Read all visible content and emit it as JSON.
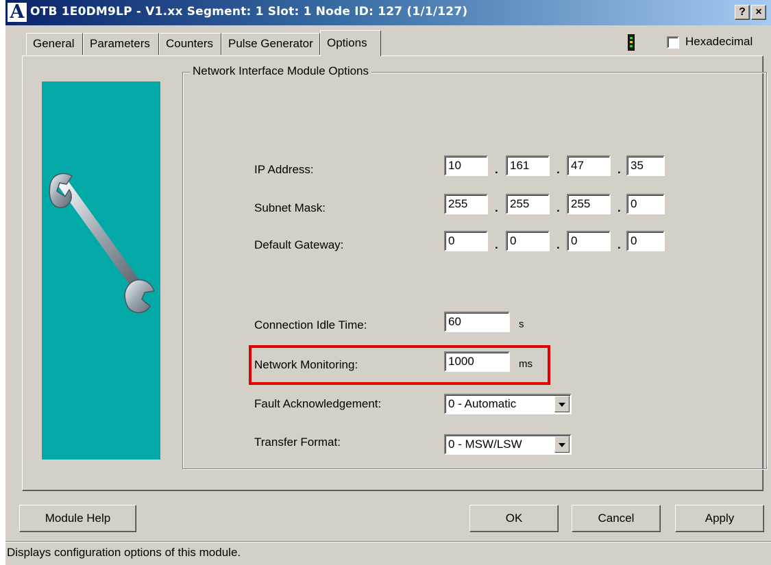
{
  "window": {
    "logo": "A",
    "title": "OTB 1E0DM9LP - V1.xx Segment: 1 Slot: 1 Node ID: 127 (1/1/127)",
    "help_button": "?",
    "close_button": "×"
  },
  "tabs": [
    {
      "label": "General"
    },
    {
      "label": "Parameters"
    },
    {
      "label": "Counters"
    },
    {
      "label": "Pulse Generator"
    },
    {
      "label": "Options"
    }
  ],
  "active_tab": "Options",
  "hexadecimal": {
    "label": "Hexadecimal",
    "checked": false
  },
  "group": {
    "title": "Network Interface Module Options"
  },
  "network": {
    "ip": {
      "label": "IP Address:",
      "octets": [
        "10",
        "161",
        "47",
        "35"
      ]
    },
    "subnet": {
      "label": "Subnet Mask:",
      "octets": [
        "255",
        "255",
        "255",
        "0"
      ]
    },
    "gateway": {
      "label": "Default Gateway:",
      "octets": [
        "0",
        "0",
        "0",
        "0"
      ]
    },
    "separator": "."
  },
  "idle_time": {
    "label": "Connection Idle Time:",
    "value": "60",
    "unit": "s"
  },
  "monitoring": {
    "label": "Network Monitoring:",
    "value": "1000",
    "unit": "ms"
  },
  "fault_ack": {
    "label": "Fault Acknowledgement:",
    "value": "0 - Automatic"
  },
  "transfer_format": {
    "label": "Transfer Format:",
    "value": "0 - MSW/LSW"
  },
  "buttons": {
    "module_help": "Module Help",
    "ok": "OK",
    "cancel": "Cancel",
    "apply": "Apply"
  },
  "status": "Displays configuration options of this module.",
  "colors": {
    "title_start": "#0a246a",
    "dialog_bg": "#d4d0c8",
    "art_bg": "#03a9a7",
    "highlight": "#e00000"
  }
}
